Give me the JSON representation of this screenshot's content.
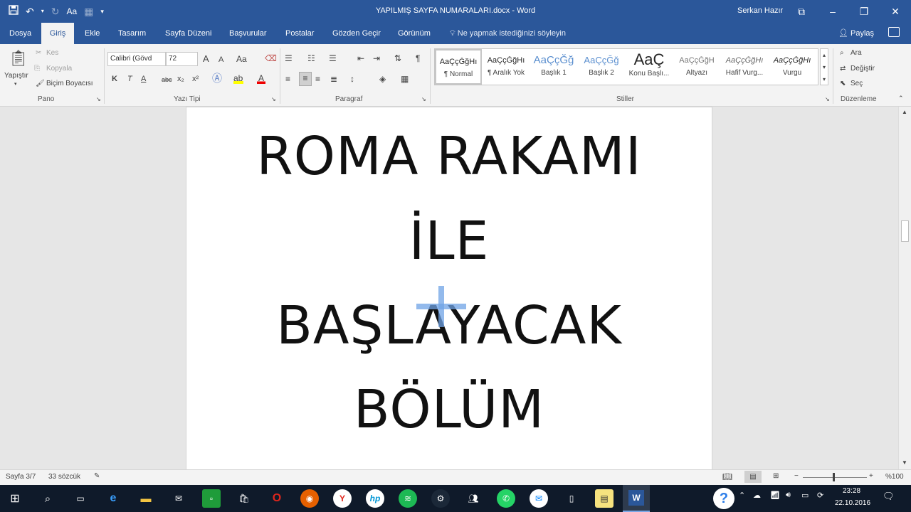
{
  "titlebar": {
    "doc_title": "YAPILMIŞ SAYFA NUMARALARI.docx - Word",
    "user": "Serkan Hazır",
    "qat_font_label": "Aa"
  },
  "tabs": [
    {
      "label": "Dosya"
    },
    {
      "label": "Giriş"
    },
    {
      "label": "Ekle"
    },
    {
      "label": "Tasarım"
    },
    {
      "label": "Sayfa Düzeni"
    },
    {
      "label": "Başvurular"
    },
    {
      "label": "Postalar"
    },
    {
      "label": "Gözden Geçir"
    },
    {
      "label": "Görünüm"
    }
  ],
  "tellme": "Ne yapmak istediğinizi söyleyin",
  "share": "Paylaş",
  "ribbon": {
    "clipboard": {
      "paste": "Yapıştır",
      "cut": "Kes",
      "copy": "Kopyala",
      "format_painter": "Biçim Boyacısı",
      "label": "Pano"
    },
    "font": {
      "name": "Calibri (Gövd",
      "size": "72",
      "label": "Yazı Tipi",
      "grow": "A",
      "shrink": "A",
      "case": "Aa",
      "bold": "K",
      "italic": "T",
      "underline": "A",
      "strike": "abc",
      "sub": "x₂",
      "sup": "x²",
      "color_a": "A"
    },
    "paragraph": {
      "label": "Paragraf"
    },
    "styles": {
      "label": "Stiller",
      "items": [
        {
          "preview": "AaÇçĞğHı",
          "name": "¶ Normal"
        },
        {
          "preview": "AaÇçĞğHı",
          "name": "¶ Aralık Yok"
        },
        {
          "preview": "AaÇçĞğ",
          "name": "Başlık 1"
        },
        {
          "preview": "AaÇçĞğ",
          "name": "Başlık 2"
        },
        {
          "preview": "AaÇ",
          "name": "Konu Başlı..."
        },
        {
          "preview": "AaÇçĞğH",
          "name": "Altyazı"
        },
        {
          "preview": "AaÇçĞğHı",
          "name": "Hafif Vurg..."
        },
        {
          "preview": "AaÇçĞğHı",
          "name": "Vurgu"
        }
      ]
    },
    "editing": {
      "find": "Ara",
      "replace": "Değiştir",
      "select": "Seç",
      "label": "Düzenleme"
    }
  },
  "document": {
    "lines": [
      "ROMA RAKAMI",
      "İLE",
      "BAŞLAYACAK",
      "BÖLÜM"
    ]
  },
  "status": {
    "page": "Sayfa 3/7",
    "words": "33 sözcük",
    "zoom": "%100"
  },
  "taskbar": {
    "time": "23:28",
    "date": "22.10.2016",
    "help": "?"
  },
  "colors": {
    "accent": "#2b579a",
    "taskbar": "#0f1a2a"
  }
}
